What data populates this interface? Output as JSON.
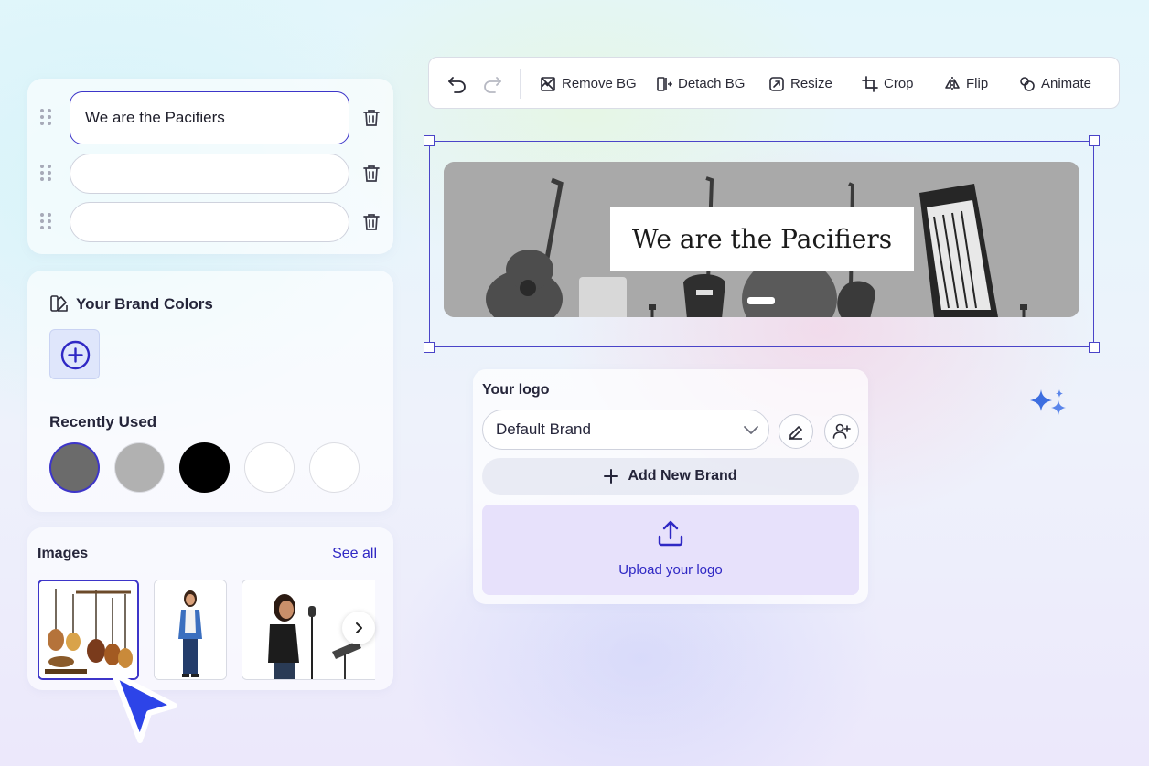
{
  "text_fields": {
    "rows": [
      {
        "value": "We are the Pacifiers"
      },
      {
        "value": ""
      },
      {
        "value": ""
      }
    ]
  },
  "brand_colors": {
    "title": "Your Brand Colors",
    "recent_title": "Recently Used",
    "recent_colors": [
      "#6b6b6b",
      "#b1b1b1",
      "#000000",
      "#ffffff",
      "#ffffff"
    ]
  },
  "images": {
    "title": "Images",
    "see_all": "See all"
  },
  "toolbar": {
    "remove_bg": "Remove BG",
    "detach_bg": "Detach BG",
    "resize": "Resize",
    "crop": "Crop",
    "flip": "Flip",
    "animate": "Animate"
  },
  "canvas": {
    "headline": "We are the Pacifiers"
  },
  "logo": {
    "title": "Your logo",
    "selected_brand": "Default Brand",
    "add_brand": "Add New Brand",
    "upload": "Upload your logo"
  },
  "colors": {
    "accent": "#3d35c9",
    "upload_bg": "#e7e1fb"
  }
}
